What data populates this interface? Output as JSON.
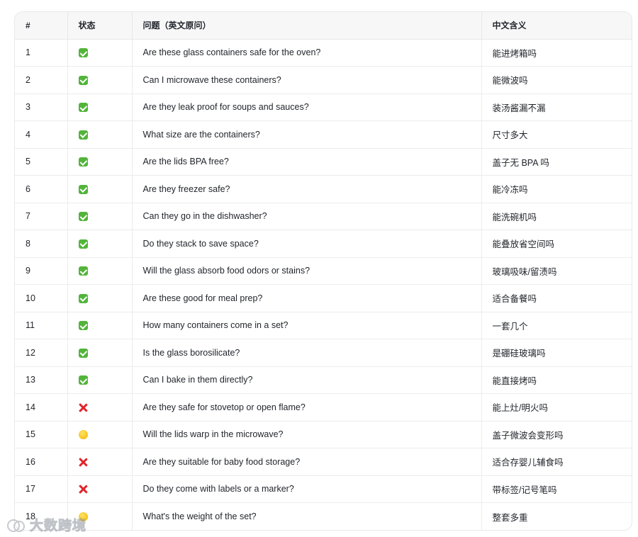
{
  "table": {
    "headers": {
      "num": "#",
      "status": "状态",
      "question": "问题（英文原问）",
      "meaning": "中文含义"
    },
    "rows": [
      {
        "num": "1",
        "status": "ok",
        "status_icon": "check-mark-icon",
        "question": "Are these glass containers safe for the oven?",
        "meaning": "能进烤箱吗"
      },
      {
        "num": "2",
        "status": "ok",
        "status_icon": "check-mark-icon",
        "question": "Can I microwave these containers?",
        "meaning": "能微波吗"
      },
      {
        "num": "3",
        "status": "ok",
        "status_icon": "check-mark-icon",
        "question": "Are they leak proof for soups and sauces?",
        "meaning": "装汤酱漏不漏"
      },
      {
        "num": "4",
        "status": "ok",
        "status_icon": "check-mark-icon",
        "question": "What size are the containers?",
        "meaning": "尺寸多大"
      },
      {
        "num": "5",
        "status": "ok",
        "status_icon": "check-mark-icon",
        "question": "Are the lids BPA free?",
        "meaning": "盖子无 BPA 吗"
      },
      {
        "num": "6",
        "status": "ok",
        "status_icon": "check-mark-icon",
        "question": "Are they freezer safe?",
        "meaning": "能冷冻吗"
      },
      {
        "num": "7",
        "status": "ok",
        "status_icon": "check-mark-icon",
        "question": "Can they go in the dishwasher?",
        "meaning": "能洗碗机吗"
      },
      {
        "num": "8",
        "status": "ok",
        "status_icon": "check-mark-icon",
        "question": "Do they stack to save space?",
        "meaning": "能叠放省空间吗"
      },
      {
        "num": "9",
        "status": "ok",
        "status_icon": "check-mark-icon",
        "question": "Will the glass absorb food odors or stains?",
        "meaning": "玻璃吸味/留渍吗"
      },
      {
        "num": "10",
        "status": "ok",
        "status_icon": "check-mark-icon",
        "question": "Are these good for meal prep?",
        "meaning": "适合备餐吗"
      },
      {
        "num": "11",
        "status": "ok",
        "status_icon": "check-mark-icon",
        "question": "How many containers come in a set?",
        "meaning": "一套几个"
      },
      {
        "num": "12",
        "status": "ok",
        "status_icon": "check-mark-icon",
        "question": "Is the glass borosilicate?",
        "meaning": "是硼硅玻璃吗"
      },
      {
        "num": "13",
        "status": "ok",
        "status_icon": "check-mark-icon",
        "question": "Can I bake in them directly?",
        "meaning": "能直接烤吗"
      },
      {
        "num": "14",
        "status": "no",
        "status_icon": "cross-mark-icon",
        "question": "Are they safe for stovetop or open flame?",
        "meaning": "能上灶/明火吗"
      },
      {
        "num": "15",
        "status": "partial",
        "status_icon": "yellow-circle-icon",
        "question": "Will the lids warp in the microwave?",
        "meaning": "盖子微波会变形吗"
      },
      {
        "num": "16",
        "status": "no",
        "status_icon": "cross-mark-icon",
        "question": "Are they suitable for baby food storage?",
        "meaning": "适合存婴儿辅食吗"
      },
      {
        "num": "17",
        "status": "no",
        "status_icon": "cross-mark-icon",
        "question": "Do they come with labels or a marker?",
        "meaning": "带标签/记号笔吗"
      },
      {
        "num": "18",
        "status": "partial",
        "status_icon": "yellow-circle-icon",
        "question": "What's the weight of the set?",
        "meaning": "整套多重"
      }
    ]
  },
  "watermark": {
    "text": "大数跨境",
    "icon": "logo-icon"
  },
  "colors": {
    "ok": "#52b43a",
    "no": "#e0262b",
    "partial": "#f6c21a",
    "border": "#e8e8ea",
    "header_bg": "#f7f7f8"
  }
}
